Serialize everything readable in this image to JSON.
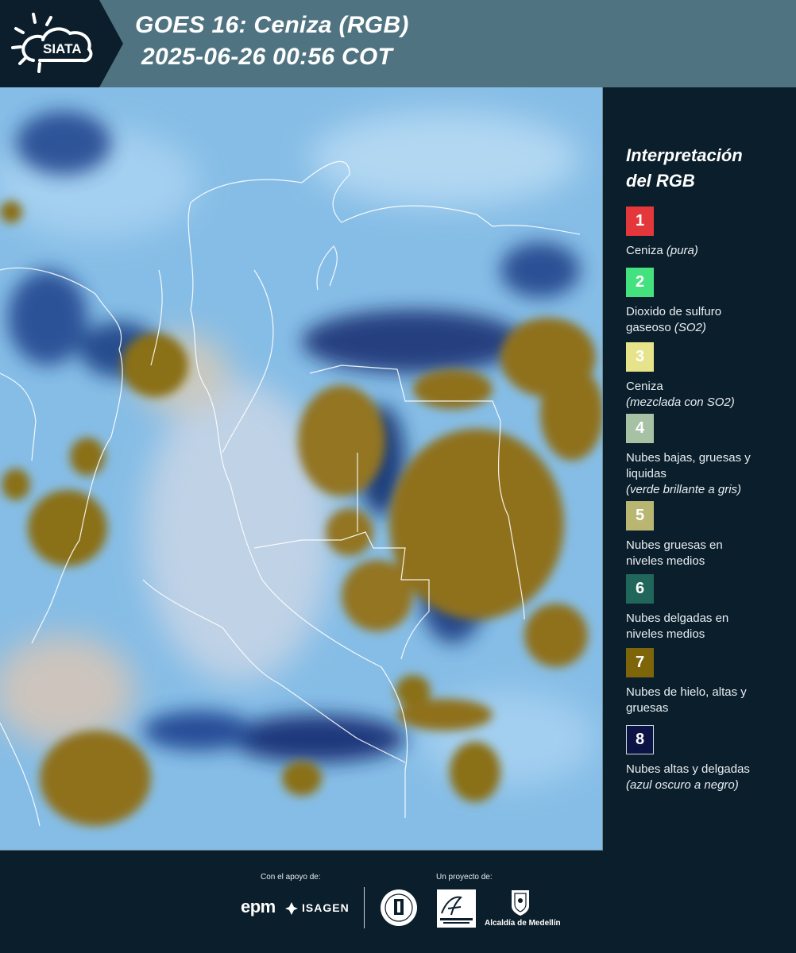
{
  "header": {
    "logo_text": "SIATA",
    "title": "GOES 16: Ceniza (RGB)",
    "datetime": "2025-06-26 00:56 COT"
  },
  "legend": {
    "title_line1": "Interpretación",
    "title_line2": "del RGB",
    "items": [
      {
        "num": "1",
        "color": "#e3373c",
        "line1": "Ceniza",
        "note1": "(pura)",
        "line2": "",
        "note2": ""
      },
      {
        "num": "2",
        "color": "#43e27e",
        "line1": "Dioxido de sulfuro",
        "note1": "",
        "line2": "gaseoso",
        "note2": "(SO2)"
      },
      {
        "num": "3",
        "color": "#e7e38a",
        "line1": "Ceniza",
        "note1": "",
        "line2": "",
        "note2": "(mezclada con SO2)"
      },
      {
        "num": "4",
        "color": "#a7c1a5",
        "line1": "Nubes bajas, gruesas y",
        "note1": "",
        "line2": "liquidas",
        "note2": "(verde brillante a gris)"
      },
      {
        "num": "5",
        "color": "#b9b672",
        "line1": "Nubes gruesas en",
        "note1": "",
        "line2": "niveles medios",
        "note2": ""
      },
      {
        "num": "6",
        "color": "#21665b",
        "line1": "Nubes delgadas en",
        "note1": "",
        "line2": "niveles medios",
        "note2": ""
      },
      {
        "num": "7",
        "color": "#7e6509",
        "line1": "Nubes de hielo, altas y",
        "note1": "",
        "line2": "gruesas",
        "note2": ""
      },
      {
        "num": "8",
        "color": "#0c1446",
        "line1": "Nubes altas y delgadas",
        "note1": "",
        "line2": "",
        "note2": "(azul oscuro a negro)"
      }
    ]
  },
  "footer": {
    "support_label": "Con el apoyo de:",
    "project_label": "Un proyecto de:",
    "epm": "epm",
    "isagen": "ISAGEN",
    "alcaldia": "Alcaldía de Medellín"
  }
}
